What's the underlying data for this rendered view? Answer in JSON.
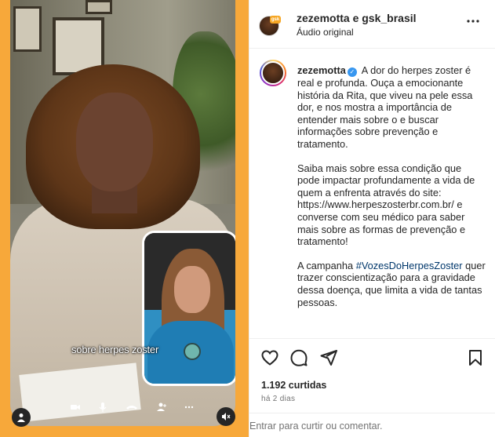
{
  "video": {
    "caption": "sobre herpes zoster"
  },
  "header": {
    "author": "zezemotta e gsk_brasil",
    "audio": "Áudio original",
    "avatar_badge": "gsk"
  },
  "post": {
    "username": "zezemotta",
    "paragraphs": [
      "A dor do herpes zoster é real e profunda. Ouça a emocionante história da Rita, que viveu na pele essa dor, e nos mostra a importância de entender mais sobre o e buscar informações sobre prevenção e tratamento.",
      "Saiba mais sobre essa condição que pode impactar profundamente a vida de quem a enfrenta através do site: https://www.herpeszosterbr.com.br/ e converse com seu médico para saber mais sobre as formas de prevenção e tratamento!"
    ],
    "para3_before": "A campanha ",
    "hashtag": "#VozesDoHerpesZoster",
    "para3_after": " quer trazer conscientização para a gravidade dessa doença, que limita a vida de tantas pessoas."
  },
  "stats": {
    "likes": "1.192 curtidas",
    "time": "há 2 dias"
  },
  "comment": {
    "placeholder": "Entrar para curtir ou comentar."
  },
  "icons": {
    "like": "heart-icon",
    "comment": "comment-icon",
    "share": "share-icon",
    "save": "bookmark-icon",
    "more": "more-icon",
    "mute": "muted-speaker-icon",
    "user": "user-tag-icon"
  },
  "colors": {
    "media_bg": "#f7a83a",
    "hashtag": "#00376b",
    "verified": "#3897f0"
  }
}
